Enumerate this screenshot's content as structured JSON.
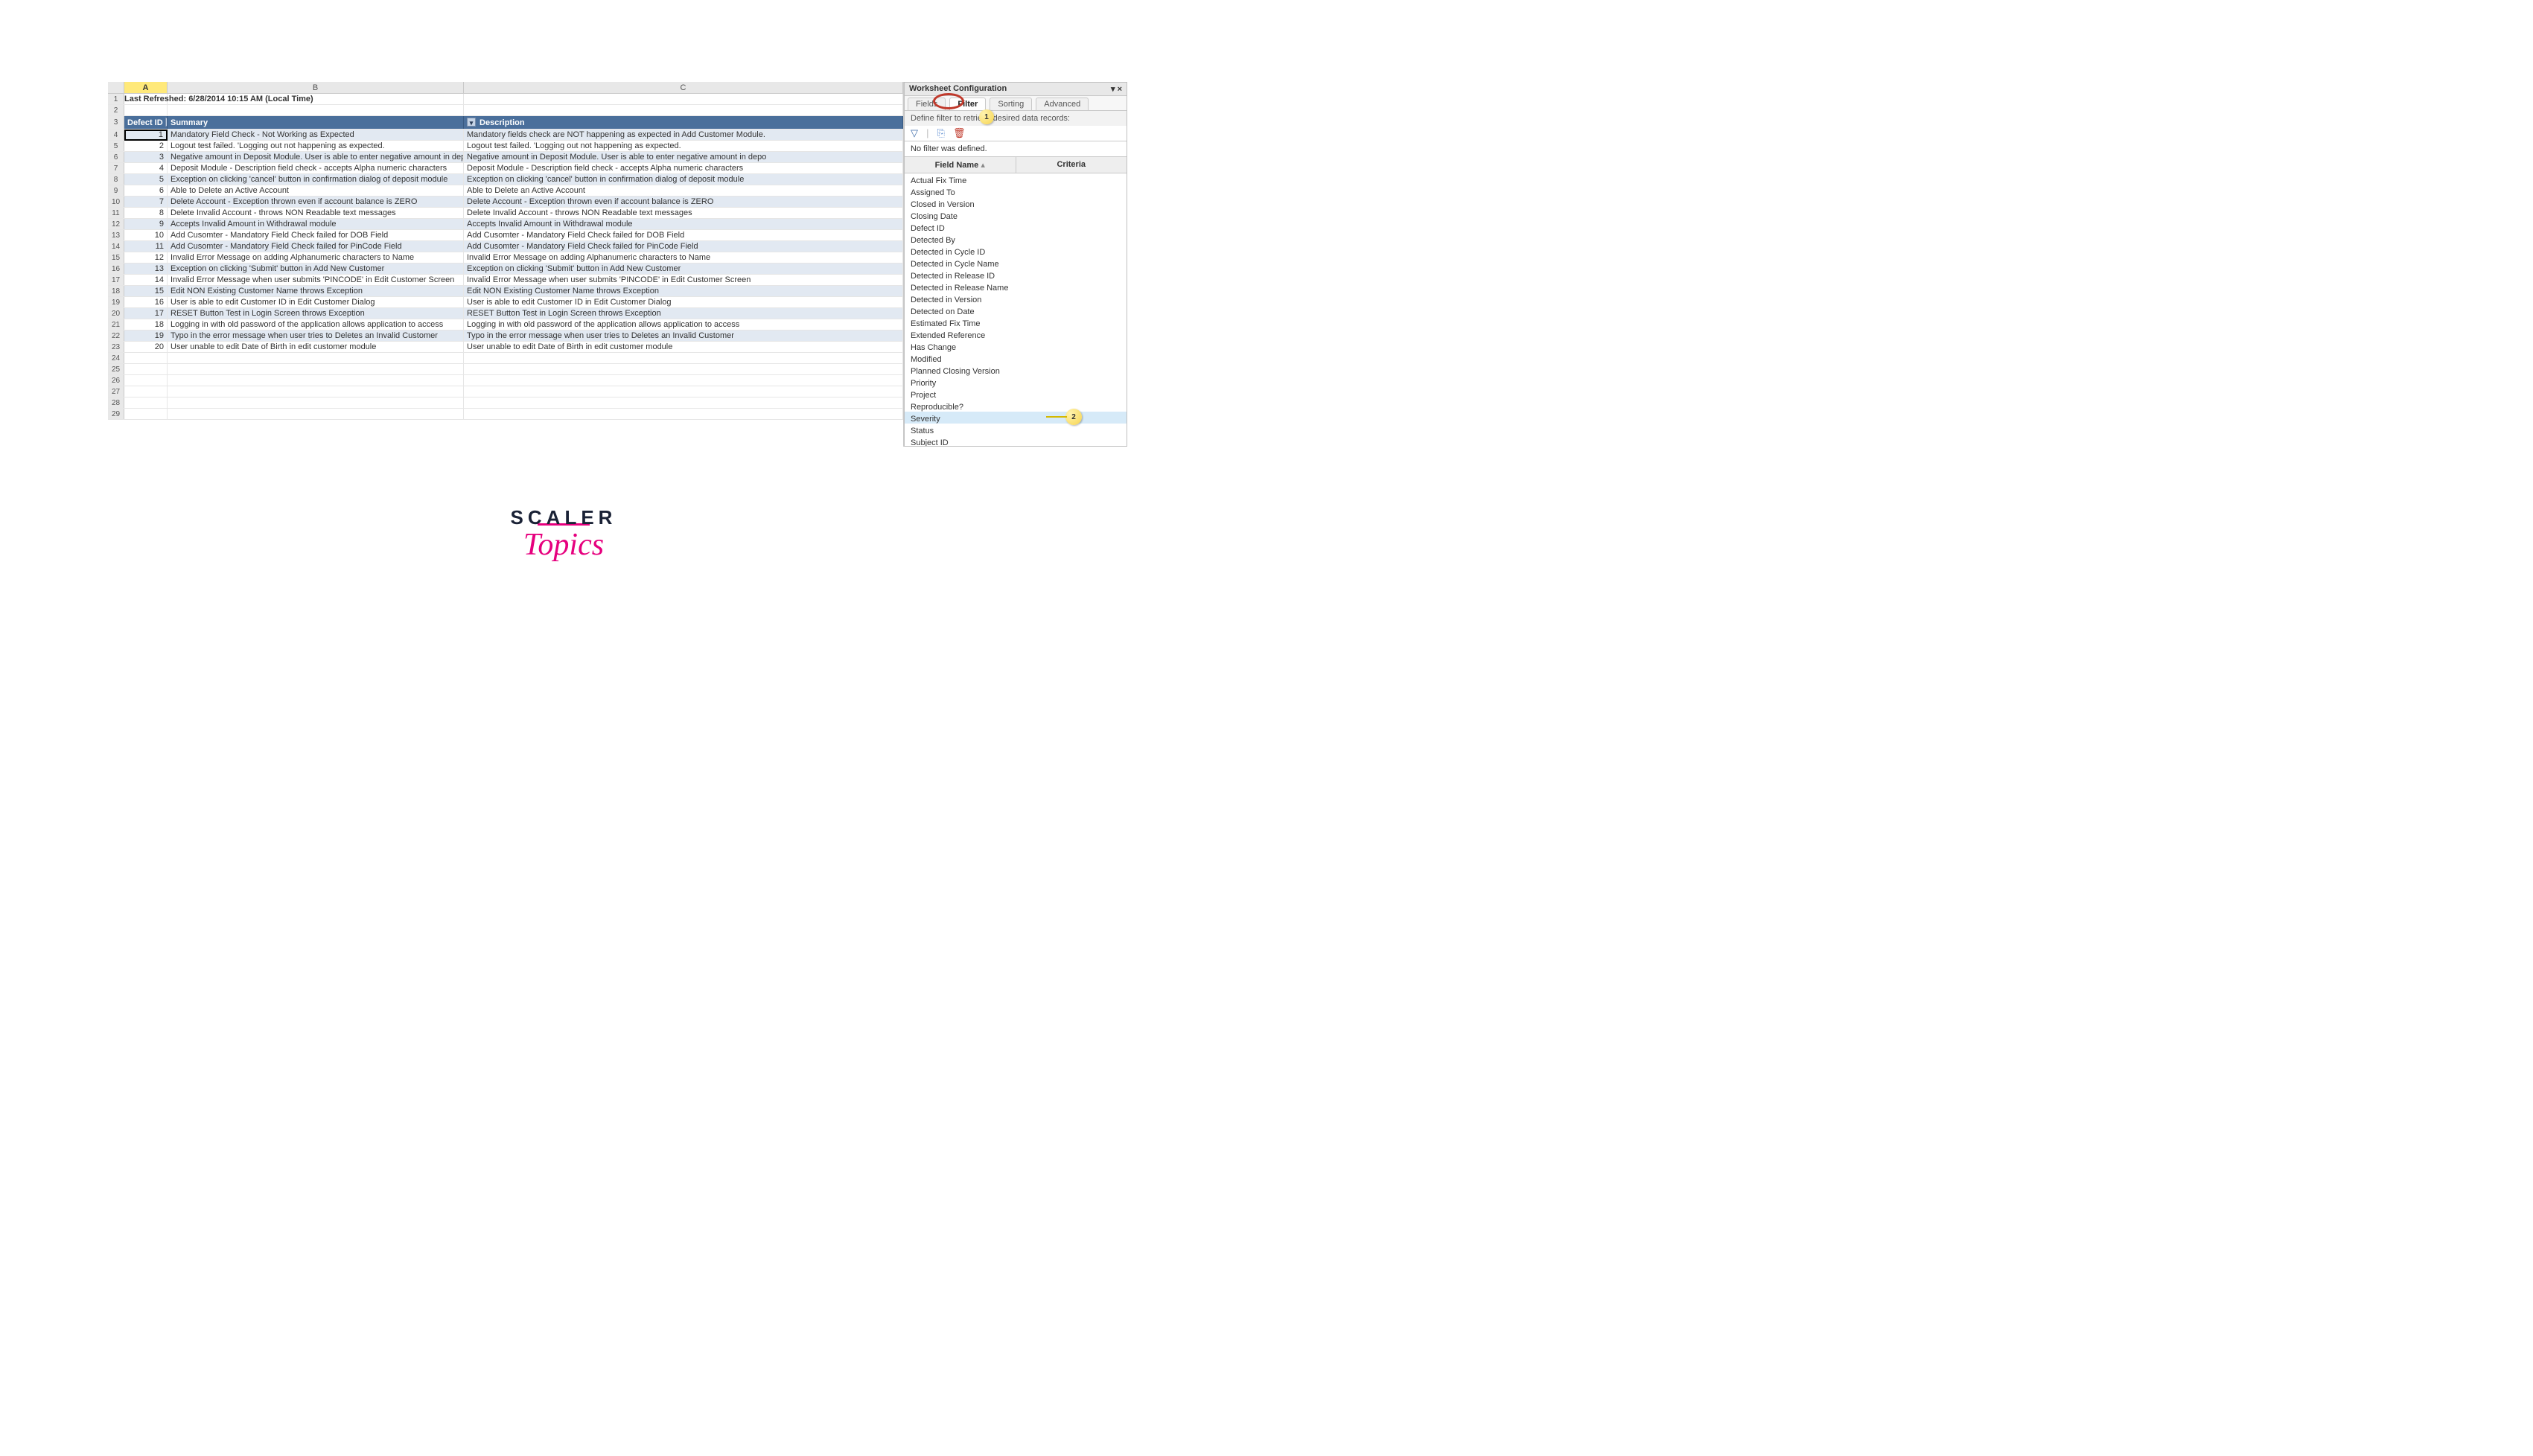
{
  "columns": {
    "A": "A",
    "B": "B",
    "C": "C"
  },
  "lastRefreshed": "Last Refreshed: 6/28/2014 10:15 AM (Local Time)",
  "headerRow": {
    "defectId": "Defect ID",
    "summary": "Summary",
    "description": "Description"
  },
  "defects": [
    {
      "id": "1",
      "summary": "Mandatory Field Check - Not Working as Expected",
      "description": "Mandatory fields check are NOT happening as expected in Add Customer Module."
    },
    {
      "id": "2",
      "summary": "Logout test failed. 'Logging out not happening as expected.",
      "description": "Logout test failed. 'Logging out not happening as expected."
    },
    {
      "id": "3",
      "summary": "Negative amount in Deposit Module. User is able to enter negative amount in deposit modu",
      "description": "Negative amount in Deposit Module. User is able to enter negative amount in depo"
    },
    {
      "id": "4",
      "summary": "Deposit Module - Description field check - accepts Alpha numeric characters",
      "description": "Deposit Module - Description field check - accepts Alpha numeric characters"
    },
    {
      "id": "5",
      "summary": "Exception on clicking 'cancel' button in confirmation dialog of deposit module",
      "description": "Exception on clicking 'cancel' button in confirmation dialog of deposit module"
    },
    {
      "id": "6",
      "summary": "Able to Delete an Active Account",
      "description": "Able to Delete an Active Account"
    },
    {
      "id": "7",
      "summary": "Delete Account - Exception thrown even if account balance is ZERO",
      "description": "Delete Account - Exception thrown even if account balance is ZERO"
    },
    {
      "id": "8",
      "summary": "Delete Invalid Account - throws NON Readable text messages",
      "description": "Delete Invalid Account - throws NON Readable text messages"
    },
    {
      "id": "9",
      "summary": "Accepts Invalid Amount in Withdrawal module",
      "description": "Accepts Invalid Amount in Withdrawal module"
    },
    {
      "id": "10",
      "summary": "Add Cusomter - Mandatory Field Check failed for DOB Field",
      "description": "Add Cusomter - Mandatory Field Check failed for DOB Field"
    },
    {
      "id": "11",
      "summary": "Add Cusomter - Mandatory Field Check failed for PinCode Field",
      "description": "Add Cusomter - Mandatory Field Check failed for PinCode Field"
    },
    {
      "id": "12",
      "summary": "Invalid Error Message on adding Alphanumeric characters to Name",
      "description": "Invalid Error Message on adding Alphanumeric characters to Name"
    },
    {
      "id": "13",
      "summary": "Exception on clicking 'Submit' button in Add New Customer",
      "description": "Exception on clicking 'Submit' button in Add New Customer"
    },
    {
      "id": "14",
      "summary": "Invalid Error Message when user submits 'PINCODE' in Edit Customer Screen",
      "description": "Invalid Error Message when user submits 'PINCODE' in Edit Customer Screen"
    },
    {
      "id": "15",
      "summary": "Edit NON Existing Customer Name throws Exception",
      "description": "Edit NON Existing Customer Name throws Exception"
    },
    {
      "id": "16",
      "summary": "User is able to edit Customer ID in Edit Customer Dialog",
      "description": "User is able to edit Customer ID in Edit Customer Dialog"
    },
    {
      "id": "17",
      "summary": "RESET Button Test in Login Screen throws Exception",
      "description": "RESET Button Test in Login Screen throws Exception"
    },
    {
      "id": "18",
      "summary": "Logging in with old password of the application allows application to access",
      "description": "Logging in with old password of the application allows application to access"
    },
    {
      "id": "19",
      "summary": "Typo in the error message when user tries to Deletes an Invalid Customer",
      "description": "Typo in the error message when user tries to Deletes an Invalid Customer"
    },
    {
      "id": "20",
      "summary": "User unable to edit Date of Birth in edit customer module",
      "description": "User unable to edit Date of Birth in edit customer module"
    }
  ],
  "emptyRowCount": 6,
  "panel": {
    "title": "Worksheet Configuration",
    "tabs": {
      "fields": "Fields",
      "filter": "Filter",
      "sorting": "Sorting",
      "advanced": "Advanced"
    },
    "desc": "Define filter to retrieve desired data records:",
    "noFilter": "No filter was defined.",
    "cols": {
      "fieldName": "Field Name",
      "criteria": "Criteria"
    },
    "fields": [
      "Actual Fix Time",
      "Assigned To",
      "Closed in Version",
      "Closing Date",
      "Defect ID",
      "Detected By",
      "Detected in Cycle ID",
      "Detected in Cycle Name",
      "Detected in Release ID",
      "Detected in Release Name",
      "Detected in Version",
      "Detected on Date",
      "Estimated Fix Time",
      "Extended Reference",
      "Has Change",
      "Modified",
      "Planned Closing Version",
      "Priority",
      "Project",
      "Reproducible?",
      "Severity",
      "Status",
      "Subject ID"
    ],
    "selectedFieldIndex": 20,
    "callout1": "1",
    "callout2": "2"
  },
  "branding": {
    "scaler": "SCALER",
    "topics": "Topics"
  }
}
